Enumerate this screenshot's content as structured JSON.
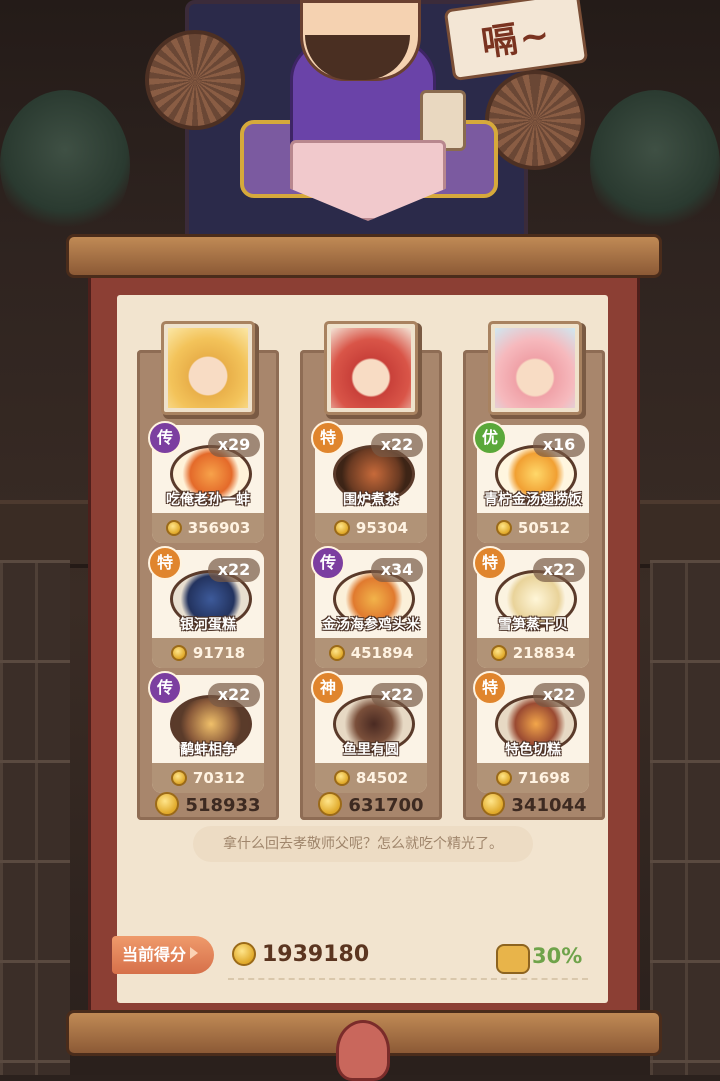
{
  "header": {
    "speech": "嗝~"
  },
  "columns": [
    {
      "portrait": "chef-blonde-girl",
      "total": "518933",
      "dishes": [
        {
          "rarity": "传",
          "count": "x29",
          "name": "吃俺老孙一蚌",
          "value": "356903"
        },
        {
          "rarity": "特",
          "count": "x22",
          "name": "银河蛋糕",
          "value": "91718"
        },
        {
          "rarity": "传",
          "count": "x22",
          "name": "鹬蚌相争",
          "value": "70312"
        }
      ]
    },
    {
      "portrait": "chef-red-hair-girl",
      "total": "631700",
      "dishes": [
        {
          "rarity": "特",
          "count": "x22",
          "name": "围炉煮茶",
          "value": "95304"
        },
        {
          "rarity": "传",
          "count": "x34",
          "name": "金汤海参鸡头米",
          "value": "451894"
        },
        {
          "rarity": "神",
          "count": "x22",
          "name": "鱼里有圆",
          "value": "84502"
        }
      ]
    },
    {
      "portrait": "chef-pink-hair-girl",
      "total": "341044",
      "dishes": [
        {
          "rarity": "优",
          "count": "x16",
          "name": "青柠金汤翅捞饭",
          "value": "50512"
        },
        {
          "rarity": "特",
          "count": "x22",
          "name": "雪笋蒸干贝",
          "value": "218834"
        },
        {
          "rarity": "特",
          "count": "x22",
          "name": "特色切糕",
          "value": "71698"
        }
      ]
    }
  ],
  "quote": "拿什么回去孝敬师父呢？怎么就吃个精光了。",
  "score": {
    "label": "当前得分",
    "total": "1939180",
    "percent": "30%"
  },
  "colors": {
    "rarity_legend": "#7c3ea0",
    "rarity_special": "#e0852d",
    "rarity_good": "#5aa83a",
    "percent": "#6fa34a"
  }
}
